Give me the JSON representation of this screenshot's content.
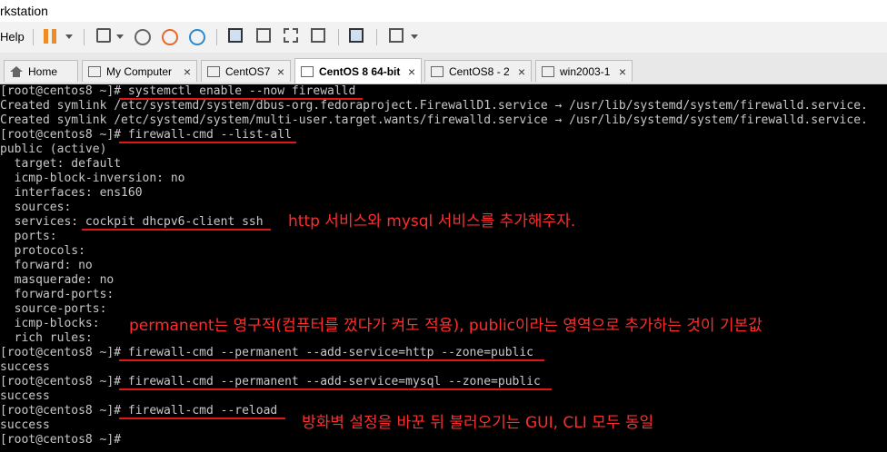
{
  "window": {
    "title": "rkstation"
  },
  "toolbar": {
    "help_label": "Help"
  },
  "tabs": [
    {
      "label": "Home"
    },
    {
      "label": "My Computer"
    },
    {
      "label": "CentOS7"
    },
    {
      "label": "CentOS 8 64-bit"
    },
    {
      "label": "CentOS8 - 2"
    },
    {
      "label": "win2003-1"
    }
  ],
  "terminal": {
    "lines": [
      "[root@centos8 ~]# systemctl enable --now firewalld",
      "Created symlink /etc/systemd/system/dbus-org.fedoraproject.FirewallD1.service → /usr/lib/systemd/system/firewalld.service.",
      "Created symlink /etc/systemd/system/multi-user.target.wants/firewalld.service → /usr/lib/systemd/system/firewalld.service.",
      "[root@centos8 ~]# firewall-cmd --list-all",
      "public (active)",
      "  target: default",
      "  icmp-block-inversion: no",
      "  interfaces: ens160",
      "  sources:",
      "  services: cockpit dhcpv6-client ssh",
      "  ports:",
      "  protocols:",
      "  forward: no",
      "  masquerade: no",
      "  forward-ports:",
      "  source-ports:",
      "  icmp-blocks:",
      "  rich rules:",
      "[root@centos8 ~]# firewall-cmd --permanent --add-service=http --zone=public",
      "success",
      "[root@centos8 ~]# firewall-cmd --permanent --add-service=mysql --zone=public",
      "success",
      "[root@centos8 ~]# firewall-cmd --reload",
      "success",
      "[root@centos8 ~]#"
    ]
  },
  "annotations": [
    "http 서비스와 mysql 서비스를 추가해주자.",
    "permanent는 영구적(컴퓨터를 껐다가 켜도 적용), public이라는 영역으로 추가하는 것이 기본값",
    "방화벽 설정을 바꾼 뒤 불러오기는 GUI, CLI 모두 동일"
  ],
  "colors": {
    "annotation": "#ff2d2d",
    "underline": "#e31515",
    "terminal_bg": "#000000",
    "terminal_fg": "#c8c8c8",
    "pause_icon": "#f08a24"
  }
}
